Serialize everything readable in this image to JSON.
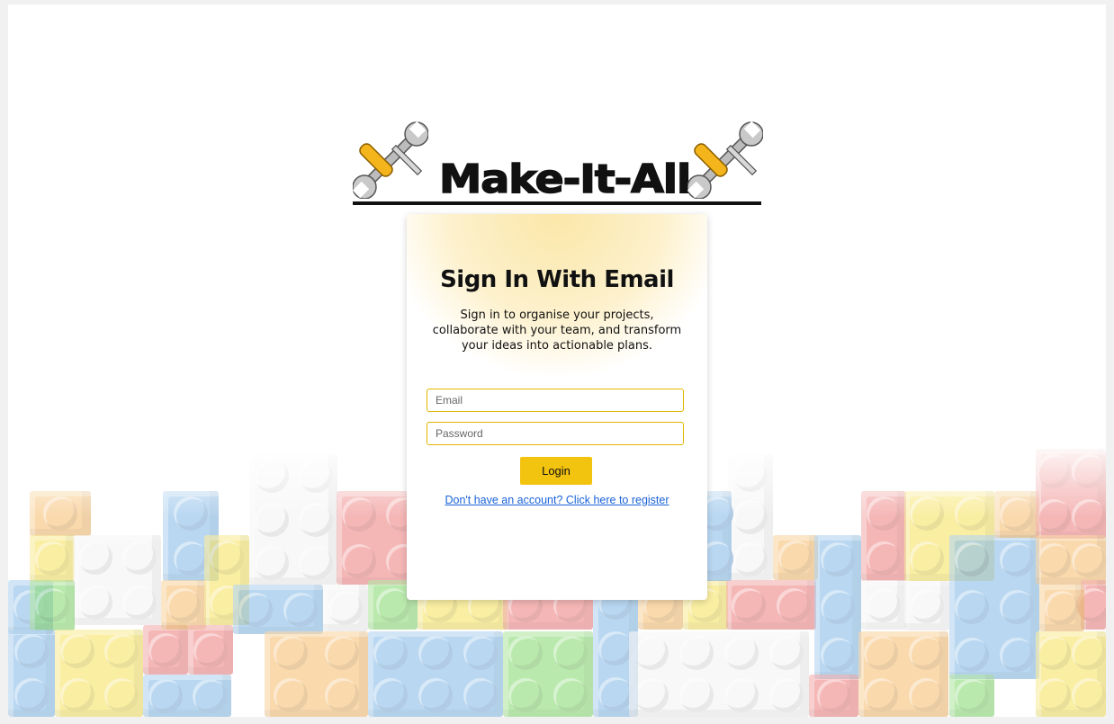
{
  "logo": {
    "text": "Make-It-All"
  },
  "signin": {
    "title": "Sign In With Email",
    "subtitle": "Sign in  to  organise your projects, collaborate with your team, and transform your ideas into actionable plans.",
    "email_placeholder": "Email",
    "password_placeholder": "Password",
    "login_label": "Login",
    "register_link": "Don't have an account? Click here to register"
  },
  "colors": {
    "accent": "#f2c30f",
    "input_border": "#e2b500",
    "link": "#1a63d8",
    "glow": "#fbe7a8"
  },
  "icons": [
    "wrench-screwdriver-icon",
    "wrench-screwdriver-icon"
  ]
}
